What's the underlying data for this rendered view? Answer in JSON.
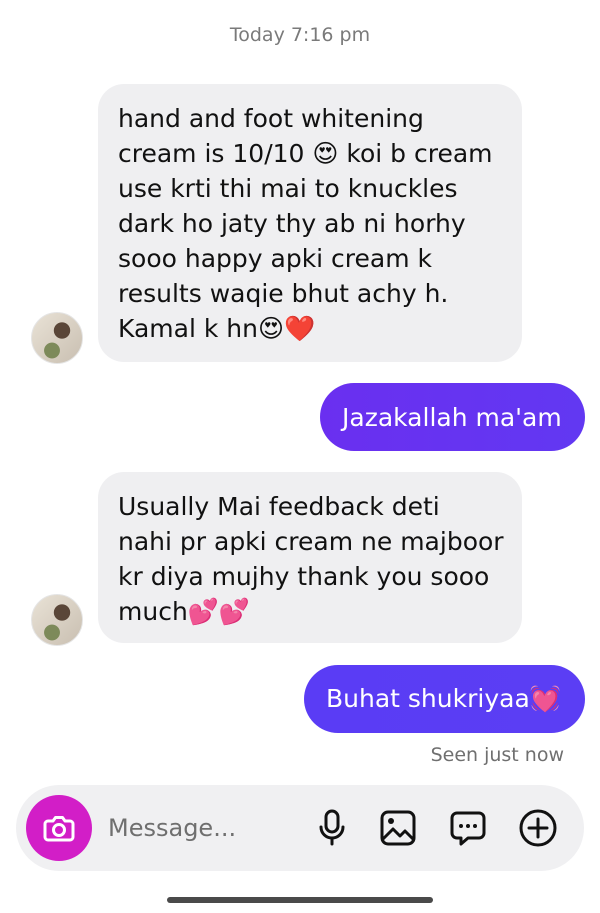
{
  "header": {
    "timestamp": "Today 7:16 pm"
  },
  "messages": [
    {
      "direction": "incoming",
      "lines": [
        "hand and foot whitening",
        "cream is 10/10 😍 koi b cream",
        "use krti thi mai to knuckles",
        "dark ho jaty thy ab ni horhy",
        "sooo happy apki cream k",
        "results waqie bhut achy h.",
        "Kamal k hn😍❤️"
      ]
    },
    {
      "direction": "outgoing",
      "text": "Jazakallah ma'am"
    },
    {
      "direction": "incoming",
      "lines": [
        "Usually Mai feedback deti",
        "nahi pr apki cream ne majboor",
        "kr diya mujhy thank you sooo",
        "much💕💕"
      ]
    },
    {
      "direction": "outgoing",
      "text": "Buhat shukriyaa💓"
    }
  ],
  "seen_status": "Seen just now",
  "composer": {
    "placeholder": "Message...",
    "icons": [
      "camera-icon",
      "microphone-icon",
      "image-icon",
      "sticker-icon",
      "plus-icon"
    ]
  },
  "colors": {
    "outgoing_start": "#6a2ff0",
    "outgoing_end": "#5a3cf5",
    "camera_button": "#d21ec7",
    "incoming_bubble": "#efeff1"
  }
}
